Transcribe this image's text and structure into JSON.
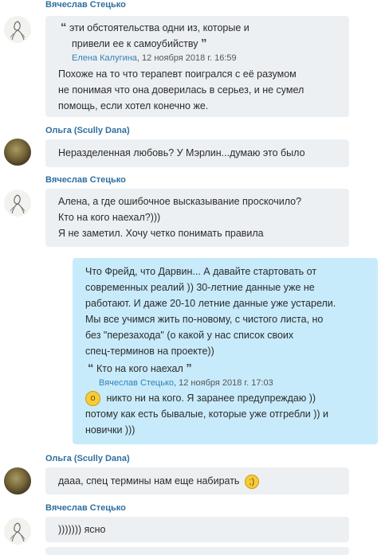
{
  "messages": [
    {
      "author": "Вячеслав Стецько",
      "quote": {
        "line1": "эти обстоятельства одни из, которые и",
        "line2": "привели ее к самоубийству",
        "author": "Елена Калугина",
        "time": "12 ноября 2018 г. 16:59"
      },
      "lines": [
        "Похоже на то что терапевт поигрался с её разумом",
        "не понимая что она доверилась в серьез, и не сумел",
        "помощь, если хотел конечно же."
      ]
    },
    {
      "author": "Ольга (Scully Dana)",
      "lines": [
        "Неразделенная любовь? У Мэрлин...думаю это было"
      ]
    },
    {
      "author": "Вячеслав Стецько",
      "lines": [
        "Алена, а где ошибочное высказывание проскочило?",
        "Кто на кого наехал?)))",
        "Я не заметил. Хочу четко понимать правила"
      ]
    },
    {
      "lines": [
        "Что Фрейд, что Дарвин... А давайте стартовать от",
        "современных реалий )) 30-летние данные уже не",
        "работают. И даже 20-10 летние данные уже устарели.",
        "Мы все учимся жить по-новому, с чистого листа, но",
        "без \"перезахода\" (о какой у нас список своих",
        "спец-терминов на проекте))"
      ],
      "quote": {
        "line1": "Кто на кого наехал",
        "author": "Вячеслав Стецько",
        "time": "12 ноября 2018 г. 17:03"
      },
      "after_lines": [
        "никто ни на кого. Я заранее предупреждаю ))",
        "потому как есть бывалые, которые уже отгребли )) и",
        "новички )))"
      ]
    },
    {
      "author": "Ольга (Scully Dana)",
      "lines": [
        "дааа, спец термины нам еще набирать"
      ]
    },
    {
      "author": "Вячеслав Стецько",
      "lines": [
        ")))))))  ясно"
      ]
    }
  ],
  "icons": {
    "quote_open": "“",
    "quote_close": "”",
    "emoji_surprised": "surprised-emoji",
    "emoji_wink": "wink-emoji"
  },
  "colors": {
    "author_name": "#2f6f9f",
    "incoming_bubble": "#edf0f3",
    "outgoing_bubble": "#c8ebfb",
    "quote_author": "#2f82b6"
  }
}
